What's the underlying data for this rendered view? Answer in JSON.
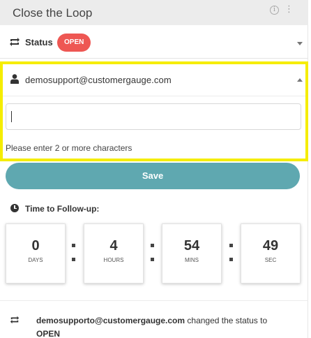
{
  "header": {
    "title": "Close the Loop",
    "info_icon": "info-icon",
    "menu_icon": "kebab-icon"
  },
  "status": {
    "label": "Status",
    "badge": "OPEN",
    "badge_color": "#ee5753",
    "icon": "repeat-icon"
  },
  "assignee": {
    "email": "demosupport@customergauge.com",
    "icon": "user-icon",
    "search": {
      "value": "",
      "hint": "Please enter 2 or more characters"
    }
  },
  "save_label": "Save",
  "save_color": "#5fa8b0",
  "followup": {
    "title": "Time to Follow-up:",
    "icon": "clock-icon",
    "units": [
      {
        "value": "0",
        "label": "DAYS"
      },
      {
        "value": "4",
        "label": "HOURS"
      },
      {
        "value": "54",
        "label": "MINS"
      },
      {
        "value": "49",
        "label": "SEC"
      }
    ]
  },
  "activity": {
    "user": "demosupporto@customergauge.com",
    "action": " changed the status to",
    "status": "OPEN",
    "icon": "repeat-icon"
  },
  "highlight_color": "#f5ed00"
}
